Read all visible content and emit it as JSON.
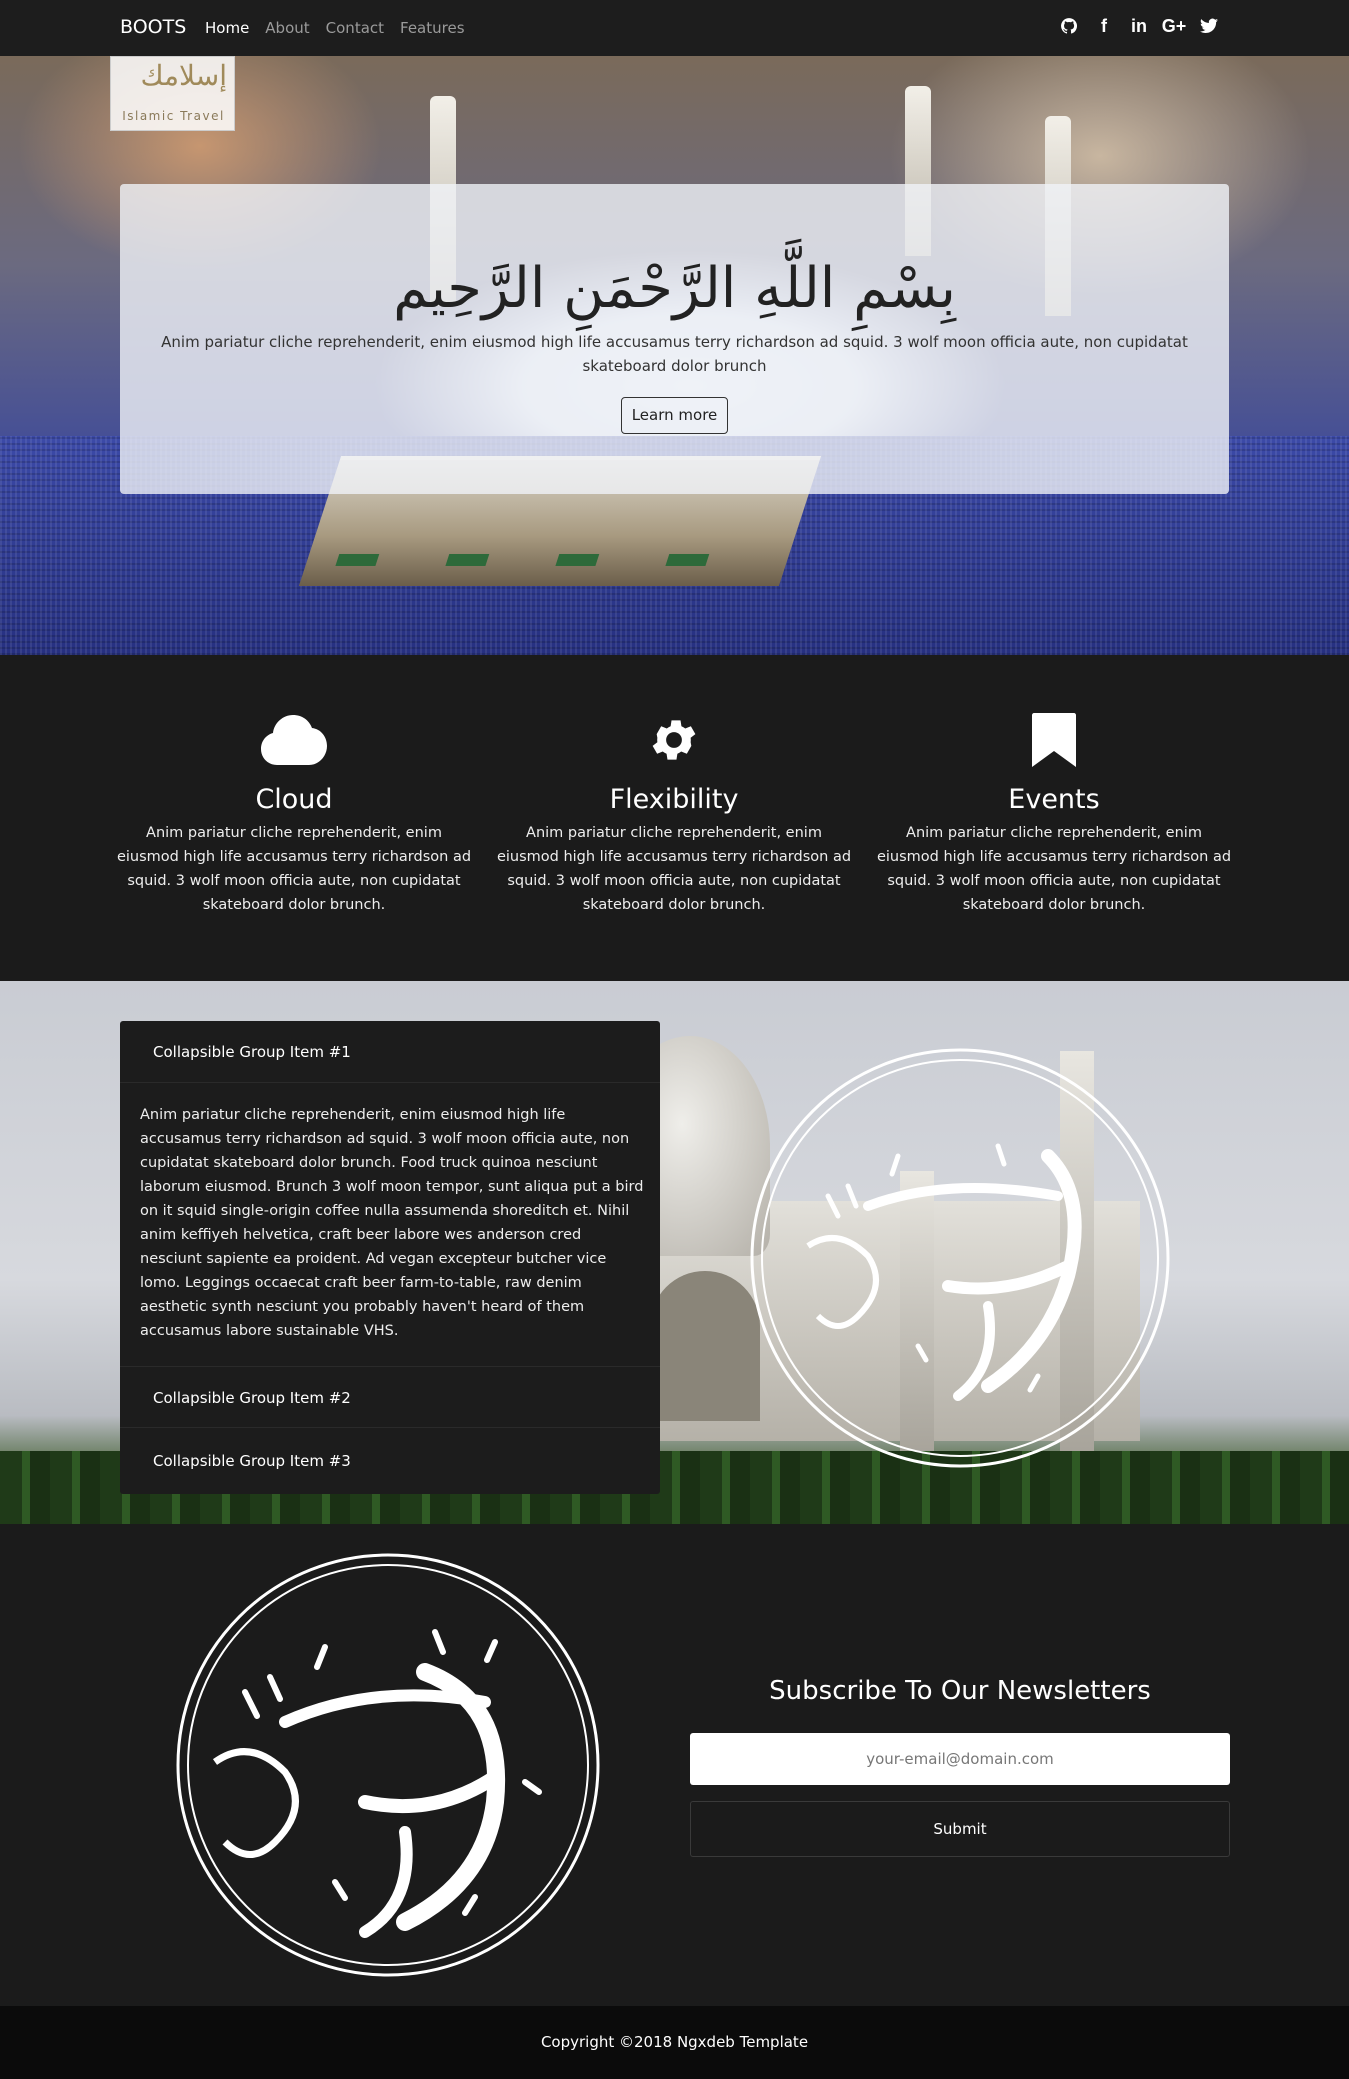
{
  "navbar": {
    "brand": "BOOTS",
    "links": [
      "Home",
      "About",
      "Contact",
      "Features"
    ],
    "social_icons": [
      "github-icon",
      "facebook-icon",
      "linkedin-icon",
      "google-plus-icon",
      "twitter-icon"
    ]
  },
  "hero": {
    "logo_ar": "إسلامك",
    "logo_en": "Islamic Travel",
    "heading": "بِسْمِ اللَّهِ الرَّحْمَنِ الرَّحِيم",
    "text": "Anim pariatur cliche reprehenderit, enim eiusmod high life accusamus terry richardson ad squid. 3 wolf moon officia aute, non cupidatat skateboard dolor brunch",
    "button": "Learn more"
  },
  "features": [
    {
      "icon": "cloud-icon",
      "title": "Cloud",
      "text": "Anim pariatur cliche reprehenderit, enim eiusmod high life accusamus terry richardson ad squid. 3 wolf moon officia aute, non cupidatat skateboard dolor brunch."
    },
    {
      "icon": "gear-icon",
      "title": "Flexibility",
      "text": "Anim pariatur cliche reprehenderit, enim eiusmod high life accusamus terry richardson ad squid. 3 wolf moon officia aute, non cupidatat skateboard dolor brunch."
    },
    {
      "icon": "bookmark-icon",
      "title": "Events",
      "text": "Anim pariatur cliche reprehenderit, enim eiusmod high life accusamus terry richardson ad squid. 3 wolf moon officia aute, non cupidatat skateboard dolor brunch."
    }
  ],
  "accordion": {
    "items": [
      {
        "title": "Collapsible Group Item #1",
        "expanded": true
      },
      {
        "title": "Collapsible Group Item #2",
        "expanded": false
      },
      {
        "title": "Collapsible Group Item #3",
        "expanded": false
      }
    ],
    "body": "Anim pariatur cliche reprehenderit, enim eiusmod high life accusamus terry richardson ad squid. 3 wolf moon officia aute, non cupidatat skateboard dolor brunch. Food truck quinoa nesciunt laborum eiusmod. Brunch 3 wolf moon tempor, sunt aliqua put a bird on it squid single-origin coffee nulla assumenda shoreditch et. Nihil anim keffiyeh helvetica, craft beer labore wes anderson cred nesciunt sapiente ea proident. Ad vegan excepteur butcher vice lomo. Leggings occaecat craft beer farm-to-table, raw denim aesthetic synth nesciunt you probably haven't heard of them accusamus labore sustainable VHS."
  },
  "newsletter": {
    "title": "Subscribe To Our Newsletters",
    "placeholder": "your-email@domain.com",
    "submit": "Submit"
  },
  "footer": {
    "copyright": "Copyright ©2018 Ngxdeb Template"
  }
}
